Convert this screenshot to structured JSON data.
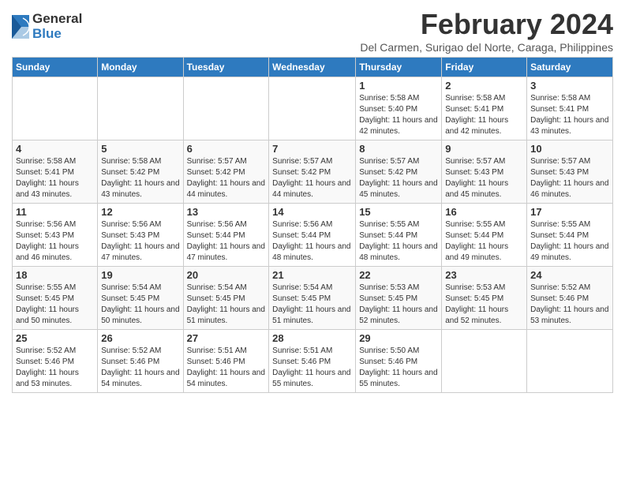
{
  "logo": {
    "general": "General",
    "blue": "Blue"
  },
  "title": "February 2024",
  "location": "Del Carmen, Surigao del Norte, Caraga, Philippines",
  "days_of_week": [
    "Sunday",
    "Monday",
    "Tuesday",
    "Wednesday",
    "Thursday",
    "Friday",
    "Saturday"
  ],
  "weeks": [
    [
      {
        "day": "",
        "info": ""
      },
      {
        "day": "",
        "info": ""
      },
      {
        "day": "",
        "info": ""
      },
      {
        "day": "",
        "info": ""
      },
      {
        "day": "1",
        "sunrise": "5:58 AM",
        "sunset": "5:40 PM",
        "daylight": "11 hours and 42 minutes."
      },
      {
        "day": "2",
        "sunrise": "5:58 AM",
        "sunset": "5:41 PM",
        "daylight": "11 hours and 42 minutes."
      },
      {
        "day": "3",
        "sunrise": "5:58 AM",
        "sunset": "5:41 PM",
        "daylight": "11 hours and 43 minutes."
      }
    ],
    [
      {
        "day": "4",
        "sunrise": "5:58 AM",
        "sunset": "5:41 PM",
        "daylight": "11 hours and 43 minutes."
      },
      {
        "day": "5",
        "sunrise": "5:58 AM",
        "sunset": "5:42 PM",
        "daylight": "11 hours and 43 minutes."
      },
      {
        "day": "6",
        "sunrise": "5:57 AM",
        "sunset": "5:42 PM",
        "daylight": "11 hours and 44 minutes."
      },
      {
        "day": "7",
        "sunrise": "5:57 AM",
        "sunset": "5:42 PM",
        "daylight": "11 hours and 44 minutes."
      },
      {
        "day": "8",
        "sunrise": "5:57 AM",
        "sunset": "5:42 PM",
        "daylight": "11 hours and 45 minutes."
      },
      {
        "day": "9",
        "sunrise": "5:57 AM",
        "sunset": "5:43 PM",
        "daylight": "11 hours and 45 minutes."
      },
      {
        "day": "10",
        "sunrise": "5:57 AM",
        "sunset": "5:43 PM",
        "daylight": "11 hours and 46 minutes."
      }
    ],
    [
      {
        "day": "11",
        "sunrise": "5:56 AM",
        "sunset": "5:43 PM",
        "daylight": "11 hours and 46 minutes."
      },
      {
        "day": "12",
        "sunrise": "5:56 AM",
        "sunset": "5:43 PM",
        "daylight": "11 hours and 47 minutes."
      },
      {
        "day": "13",
        "sunrise": "5:56 AM",
        "sunset": "5:44 PM",
        "daylight": "11 hours and 47 minutes."
      },
      {
        "day": "14",
        "sunrise": "5:56 AM",
        "sunset": "5:44 PM",
        "daylight": "11 hours and 48 minutes."
      },
      {
        "day": "15",
        "sunrise": "5:55 AM",
        "sunset": "5:44 PM",
        "daylight": "11 hours and 48 minutes."
      },
      {
        "day": "16",
        "sunrise": "5:55 AM",
        "sunset": "5:44 PM",
        "daylight": "11 hours and 49 minutes."
      },
      {
        "day": "17",
        "sunrise": "5:55 AM",
        "sunset": "5:44 PM",
        "daylight": "11 hours and 49 minutes."
      }
    ],
    [
      {
        "day": "18",
        "sunrise": "5:55 AM",
        "sunset": "5:45 PM",
        "daylight": "11 hours and 50 minutes."
      },
      {
        "day": "19",
        "sunrise": "5:54 AM",
        "sunset": "5:45 PM",
        "daylight": "11 hours and 50 minutes."
      },
      {
        "day": "20",
        "sunrise": "5:54 AM",
        "sunset": "5:45 PM",
        "daylight": "11 hours and 51 minutes."
      },
      {
        "day": "21",
        "sunrise": "5:54 AM",
        "sunset": "5:45 PM",
        "daylight": "11 hours and 51 minutes."
      },
      {
        "day": "22",
        "sunrise": "5:53 AM",
        "sunset": "5:45 PM",
        "daylight": "11 hours and 52 minutes."
      },
      {
        "day": "23",
        "sunrise": "5:53 AM",
        "sunset": "5:45 PM",
        "daylight": "11 hours and 52 minutes."
      },
      {
        "day": "24",
        "sunrise": "5:52 AM",
        "sunset": "5:46 PM",
        "daylight": "11 hours and 53 minutes."
      }
    ],
    [
      {
        "day": "25",
        "sunrise": "5:52 AM",
        "sunset": "5:46 PM",
        "daylight": "11 hours and 53 minutes."
      },
      {
        "day": "26",
        "sunrise": "5:52 AM",
        "sunset": "5:46 PM",
        "daylight": "11 hours and 54 minutes."
      },
      {
        "day": "27",
        "sunrise": "5:51 AM",
        "sunset": "5:46 PM",
        "daylight": "11 hours and 54 minutes."
      },
      {
        "day": "28",
        "sunrise": "5:51 AM",
        "sunset": "5:46 PM",
        "daylight": "11 hours and 55 minutes."
      },
      {
        "day": "29",
        "sunrise": "5:50 AM",
        "sunset": "5:46 PM",
        "daylight": "11 hours and 55 minutes."
      },
      {
        "day": "",
        "info": ""
      },
      {
        "day": "",
        "info": ""
      }
    ]
  ]
}
